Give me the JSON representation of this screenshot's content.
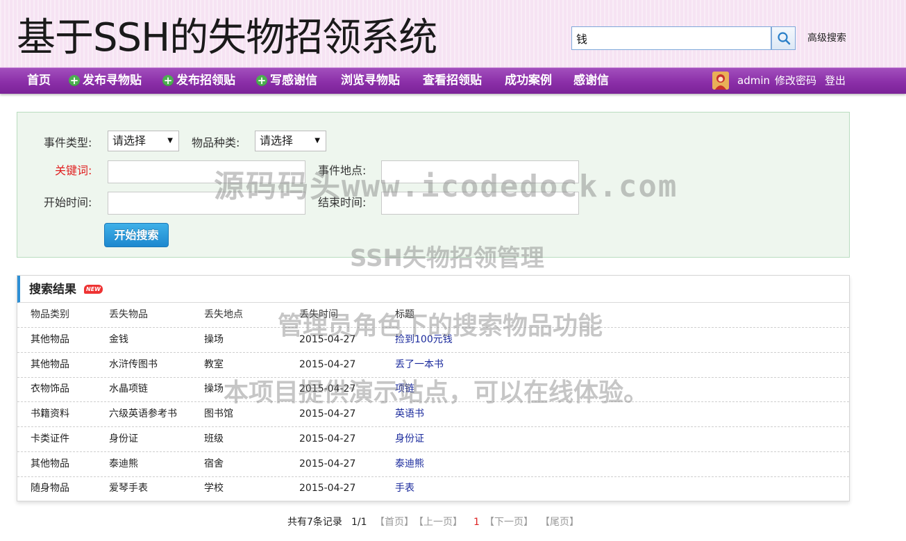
{
  "header": {
    "title": "基于SSH的失物招领系统",
    "search_value": "钱",
    "advanced_search": "高级搜索"
  },
  "nav": {
    "items": [
      {
        "label": "首页",
        "icon": ""
      },
      {
        "label": "发布寻物贴",
        "icon": "plus-circle-icon"
      },
      {
        "label": "发布招领贴",
        "icon": "plus-circle-icon"
      },
      {
        "label": "写感谢信",
        "icon": "plus-circle-icon"
      },
      {
        "label": "浏览寻物贴",
        "icon": ""
      },
      {
        "label": "查看招领贴",
        "icon": ""
      },
      {
        "label": "成功案例",
        "icon": ""
      },
      {
        "label": "感谢信",
        "icon": ""
      }
    ],
    "user": "admin",
    "change_password": "修改密码",
    "logout": "登出"
  },
  "form": {
    "event_type_label": "事件类型:",
    "event_type_value": "请选择",
    "item_type_label": "物品种类:",
    "item_type_value": "请选择",
    "keyword_label": "关键词:",
    "location_label": "事件地点:",
    "start_time_label": "开始时间:",
    "end_time_label": "结束时间:",
    "search_button": "开始搜索"
  },
  "results": {
    "title": "搜索结果",
    "badge": "NEW",
    "columns": [
      "物品类别",
      "丢失物品",
      "丢失地点",
      "丢失时间",
      "标题"
    ],
    "rows": [
      [
        "其他物品",
        "金钱",
        "操场",
        "2015-04-27",
        "捡到100元钱"
      ],
      [
        "其他物品",
        "水浒传图书",
        "教室",
        "2015-04-27",
        "丢了一本书"
      ],
      [
        "衣物饰品",
        "水晶项链",
        "操场",
        "2015-04-27",
        "项链"
      ],
      [
        "书籍资料",
        "六级英语参考书",
        "图书馆",
        "2015-04-27",
        "英语书"
      ],
      [
        "卡类证件",
        "身份证",
        "班级",
        "2015-04-27",
        "身份证"
      ],
      [
        "其他物品",
        "泰迪熊",
        "宿舍",
        "2015-04-27",
        "泰迪熊"
      ],
      [
        "随身物品",
        "爱琴手表",
        "学校",
        "2015-04-27",
        "手表"
      ]
    ]
  },
  "pagination": {
    "total": "共有7条记录",
    "page": "1/1",
    "first": "【首页】",
    "prev": "【上一页】",
    "current": "1",
    "next": "【下一页】",
    "last": "【尾页】"
  },
  "watermark": {
    "line1": "源码码头www.icodedock.com",
    "line2": "SSH失物招领管理",
    "line3": "管理员角色下的搜索物品功能",
    "line4": "本项目提供演示站点，可以在线体验。"
  },
  "colors": {
    "nav_purple": "#8b2fa8",
    "header_pink": "#f6e3f3",
    "form_green": "#eef6ee",
    "link_blue": "#1a2a9c",
    "button_blue": "#1d88cf"
  }
}
